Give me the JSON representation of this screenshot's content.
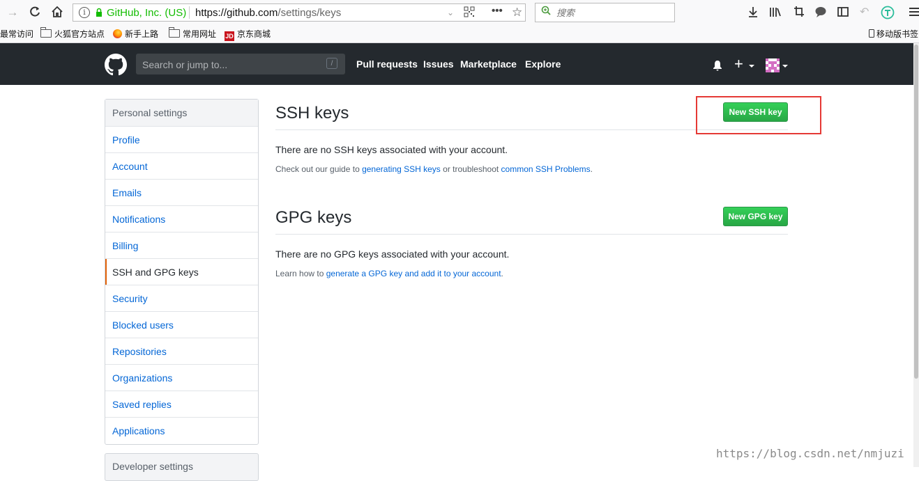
{
  "browser": {
    "url_owner": "GitHub, Inc. (US)",
    "url_host": "https://github.com",
    "url_path": "/settings/keys",
    "search_placeholder": "搜索",
    "bookmarks": [
      "最常访问",
      "火狐官方站点",
      "新手上路",
      "常用网址",
      "京东商城"
    ],
    "mobile_bookmarks": "移动版书签"
  },
  "header": {
    "search_placeholder": "Search or jump to...",
    "slash_key": "/",
    "nav": [
      "Pull requests",
      "Issues",
      "Marketplace",
      "Explore"
    ]
  },
  "sidebar": {
    "title": "Personal settings",
    "items": [
      {
        "label": "Profile"
      },
      {
        "label": "Account"
      },
      {
        "label": "Emails"
      },
      {
        "label": "Notifications"
      },
      {
        "label": "Billing"
      },
      {
        "label": "SSH and GPG keys",
        "selected": true
      },
      {
        "label": "Security"
      },
      {
        "label": "Blocked users"
      },
      {
        "label": "Repositories"
      },
      {
        "label": "Organizations"
      },
      {
        "label": "Saved replies"
      },
      {
        "label": "Applications"
      }
    ],
    "developer_title": "Developer settings"
  },
  "ssh": {
    "title": "SSH keys",
    "button": "New SSH key",
    "empty": "There are no SSH keys associated with your account.",
    "guide_prefix": "Check out our guide to ",
    "guide_link": "generating SSH keys",
    "guide_middle": " or troubleshoot ",
    "guide_link2": "common SSH Problems",
    "guide_suffix": "."
  },
  "gpg": {
    "title": "GPG keys",
    "button": "New GPG key",
    "empty": "There are no GPG keys associated with your account.",
    "learn_prefix": "Learn how to ",
    "learn_link": "generate a GPG key and add it to your account",
    "learn_suffix": "."
  },
  "watermark": "https://blog.csdn.net/nmjuzi",
  "colors": {
    "header_bg": "#24292e",
    "link": "#0366d6",
    "button_green": "#28a745",
    "highlight_red": "#e53935",
    "selected_accent": "#e36209"
  }
}
